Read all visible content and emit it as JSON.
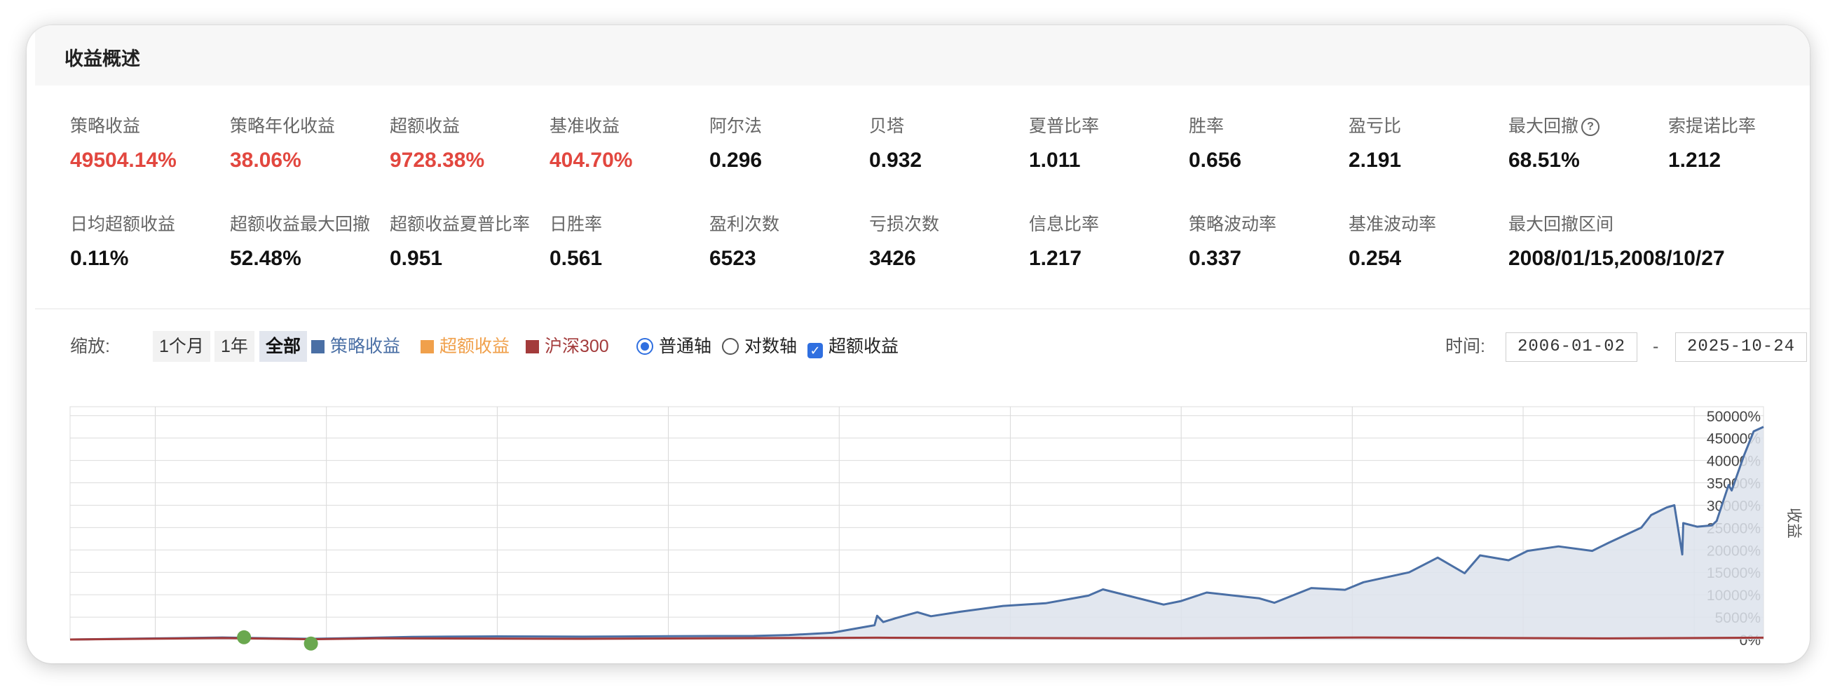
{
  "header": {
    "title": "收益概述"
  },
  "stats_row1": [
    {
      "label": "策略收益",
      "value": "49504.14%",
      "highlight": true
    },
    {
      "label": "策略年化收益",
      "value": "38.06%",
      "highlight": true
    },
    {
      "label": "超额收益",
      "value": "9728.38%",
      "highlight": true
    },
    {
      "label": "基准收益",
      "value": "404.70%",
      "highlight": true
    },
    {
      "label": "阿尔法",
      "value": "0.296",
      "highlight": false
    },
    {
      "label": "贝塔",
      "value": "0.932",
      "highlight": false
    },
    {
      "label": "夏普比率",
      "value": "1.011",
      "highlight": false
    },
    {
      "label": "胜率",
      "value": "0.656",
      "highlight": false
    },
    {
      "label": "盈亏比",
      "value": "2.191",
      "highlight": false
    },
    {
      "label": "最大回撤",
      "value": "68.51%",
      "highlight": false,
      "help_icon": "question-circle-icon"
    },
    {
      "label": "索提诺比率",
      "value": "1.212",
      "highlight": false
    }
  ],
  "stats_row2": [
    {
      "label": "日均超额收益",
      "value": "0.11%"
    },
    {
      "label": "超额收益最大回撤",
      "value": "52.48%"
    },
    {
      "label": "超额收益夏普比率",
      "value": "0.951"
    },
    {
      "label": "日胜率",
      "value": "0.561"
    },
    {
      "label": "盈利次数",
      "value": "6523"
    },
    {
      "label": "亏损次数",
      "value": "3426"
    },
    {
      "label": "信息比率",
      "value": "1.217"
    },
    {
      "label": "策略波动率",
      "value": "0.337"
    },
    {
      "label": "基准波动率",
      "value": "0.254"
    },
    {
      "label": "最大回撤区间",
      "value": "2008/01/15,2008/10/27"
    }
  ],
  "controls": {
    "zoom_label": "缩放:",
    "zoom_buttons": [
      "1个月",
      "1年",
      "全部"
    ],
    "zoom_active": "全部",
    "legend": [
      {
        "name": "策略收益",
        "color": "#4a6fa5"
      },
      {
        "name": "超额收益",
        "color": "#f0a04b"
      },
      {
        "name": "沪深300",
        "color": "#a33b3b"
      }
    ],
    "axis_options": [
      "普通轴",
      "对数轴"
    ],
    "axis_selected": "普通轴",
    "excess_checkbox_label": "超额收益",
    "excess_checked": true,
    "time_label": "时间:",
    "date_from": "2006-01-02",
    "date_to": "2025-10-24",
    "date_separator": "-"
  },
  "chart_data": {
    "type": "area",
    "y_axis_label": "收益",
    "y_axis_position": "right",
    "ylim": [
      0,
      52000
    ],
    "y_ticks": [
      0,
      5000,
      10000,
      15000,
      20000,
      25000,
      30000,
      35000,
      40000,
      45000,
      50000
    ],
    "y_tick_labels": [
      "0%",
      "5000%",
      "10000%",
      "15000%",
      "20000%",
      "25000%",
      "30000%",
      "35000%",
      "40000%",
      "45000%",
      "50000%"
    ],
    "x_range": [
      "2006-01-02",
      "2025-10-24"
    ],
    "grid": true,
    "series": [
      {
        "name": "策略收益",
        "color": "#4a6fa5",
        "fill": "#dde3ec",
        "points": [
          [
            "2006-01-02",
            0
          ],
          [
            "2007-01-01",
            250
          ],
          [
            "2007-10-15",
            450
          ],
          [
            "2008-01-15",
            380
          ],
          [
            "2008-10-27",
            150
          ],
          [
            "2009-06-01",
            350
          ],
          [
            "2010-01-01",
            600
          ],
          [
            "2011-01-01",
            700
          ],
          [
            "2012-01-01",
            650
          ],
          [
            "2013-01-01",
            750
          ],
          [
            "2014-01-01",
            800
          ],
          [
            "2014-06-01",
            1000
          ],
          [
            "2014-12-01",
            1500
          ],
          [
            "2015-06-01",
            3200
          ],
          [
            "2015-06-12",
            5300
          ],
          [
            "2015-07-08",
            3900
          ],
          [
            "2015-09-01",
            4800
          ],
          [
            "2015-12-01",
            6100
          ],
          [
            "2016-01-28",
            5200
          ],
          [
            "2016-06-01",
            6200
          ],
          [
            "2016-12-01",
            7500
          ],
          [
            "2017-06-01",
            8100
          ],
          [
            "2017-12-01",
            9800
          ],
          [
            "2018-02-01",
            11200
          ],
          [
            "2018-10-18",
            7800
          ],
          [
            "2019-01-01",
            8600
          ],
          [
            "2019-04-20",
            10500
          ],
          [
            "2019-12-01",
            9200
          ],
          [
            "2020-02-03",
            8200
          ],
          [
            "2020-07-10",
            11500
          ],
          [
            "2020-12-01",
            11100
          ],
          [
            "2021-02-18",
            12800
          ],
          [
            "2021-09-01",
            15000
          ],
          [
            "2022-01-01",
            18300
          ],
          [
            "2022-04-26",
            14800
          ],
          [
            "2022-07-01",
            18800
          ],
          [
            "2022-10-31",
            17700
          ],
          [
            "2023-01-20",
            19800
          ],
          [
            "2023-06-01",
            20800
          ],
          [
            "2023-10-23",
            19800
          ],
          [
            "2024-01-01",
            21600
          ],
          [
            "2024-05-20",
            25000
          ],
          [
            "2024-07-01",
            27800
          ],
          [
            "2024-09-05",
            29500
          ],
          [
            "2024-10-08",
            30000
          ],
          [
            "2024-11-11",
            19000
          ],
          [
            "2024-11-15",
            26000
          ],
          [
            "2025-01-13",
            25200
          ],
          [
            "2025-03-18",
            25500
          ],
          [
            "2025-04-07",
            26500
          ],
          [
            "2025-05-28",
            34500
          ],
          [
            "2025-06-10",
            33300
          ],
          [
            "2025-08-01",
            41000
          ],
          [
            "2025-09-12",
            46500
          ],
          [
            "2025-10-24",
            47500
          ]
        ]
      },
      {
        "name": "沪深300",
        "color": "#a33b3b",
        "points": [
          [
            "2006-01-02",
            0
          ],
          [
            "2007-10-15",
            330
          ],
          [
            "2008-10-27",
            60
          ],
          [
            "2009-08-04",
            260
          ],
          [
            "2012-01-01",
            150
          ],
          [
            "2015-06-12",
            400
          ],
          [
            "2018-12-01",
            260
          ],
          [
            "2021-02-18",
            450
          ],
          [
            "2024-01-01",
            250
          ],
          [
            "2025-10-24",
            405
          ]
        ]
      }
    ],
    "markers": [
      {
        "date": "2008-01-15",
        "value": 500,
        "color": "#6aa84f"
      },
      {
        "date": "2008-10-27",
        "value": -900,
        "color": "#6aa84f"
      }
    ]
  }
}
